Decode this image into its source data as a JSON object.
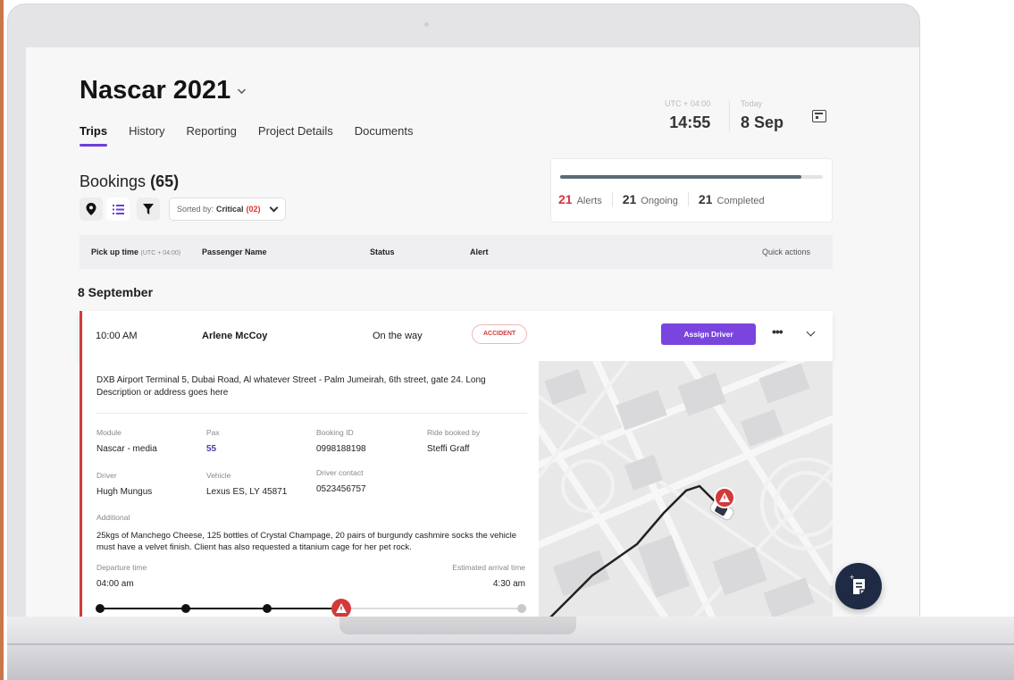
{
  "project": {
    "title": "Nascar 2021"
  },
  "tabs": [
    {
      "label": "Trips",
      "active": true
    },
    {
      "label": "History",
      "active": false
    },
    {
      "label": "Reporting",
      "active": false
    },
    {
      "label": "Project Details",
      "active": false
    },
    {
      "label": "Documents",
      "active": false
    }
  ],
  "clock": {
    "timezone": "UTC + 04:00",
    "time": "14:55",
    "today_label": "Today",
    "date": "8 Sep"
  },
  "bookings": {
    "title": "Bookings",
    "count": "(65)"
  },
  "sort": {
    "prefix": "Sorted by:",
    "value": "Critical",
    "count": "(02)"
  },
  "stats": {
    "progress": 0.92,
    "alerts_count": "21",
    "alerts_label": "Alerts",
    "ongoing_count": "21",
    "ongoing_label": "Ongoing",
    "completed_count": "21",
    "completed_label": "Completed"
  },
  "table_header": {
    "pickup": "Pick up time",
    "pickup_tz": "(UTC + 04:00)",
    "passenger": "Passenger Name",
    "status": "Status",
    "alert": "Alert",
    "actions": "Quick actions"
  },
  "date_heading": "8 September",
  "booking": {
    "time": "10:00 AM",
    "passenger": "Arlene McCoy",
    "status": "On the way",
    "alert": "ACCIDENT",
    "assign_label": "Assign Driver",
    "more_label": "•••"
  },
  "details": {
    "address": "DXB Airport Terminal 5, Dubai Road, Al whatever Street - Palm Jumeirah, 6th street, gate 24. Long Description or address goes here",
    "module_label": "Module",
    "module": "Nascar - media",
    "pax_label": "Pax",
    "pax": "55",
    "booking_id_label": "Booking ID",
    "booking_id": "0998188198",
    "ride_by_label": "Ride booked by",
    "ride_by": "Steffi Graff",
    "driver_label": "Driver",
    "driver": "Hugh Mungus",
    "vehicle_label": "Vehicle",
    "vehicle": "Lexus ES, LY 45871",
    "driver_contact_label": "Driver contact",
    "driver_contact": "0523456757",
    "additional_label": "Additional",
    "additional": "25kgs of Manchego Cheese, 125 bottles of Crystal Champage,  20 pairs of burgundy cashmire socks the vehicle must have a velvet finish. Client has also requested a titanium cage for her pet rock.",
    "departure_label": "Departure time",
    "departure": "04:00 am",
    "arrival_label": "Estimated arrival time",
    "arrival": "4:30 am"
  },
  "colors": {
    "accent": "#7a45df",
    "alert": "#d23a3a",
    "fab": "#1f2a44"
  }
}
